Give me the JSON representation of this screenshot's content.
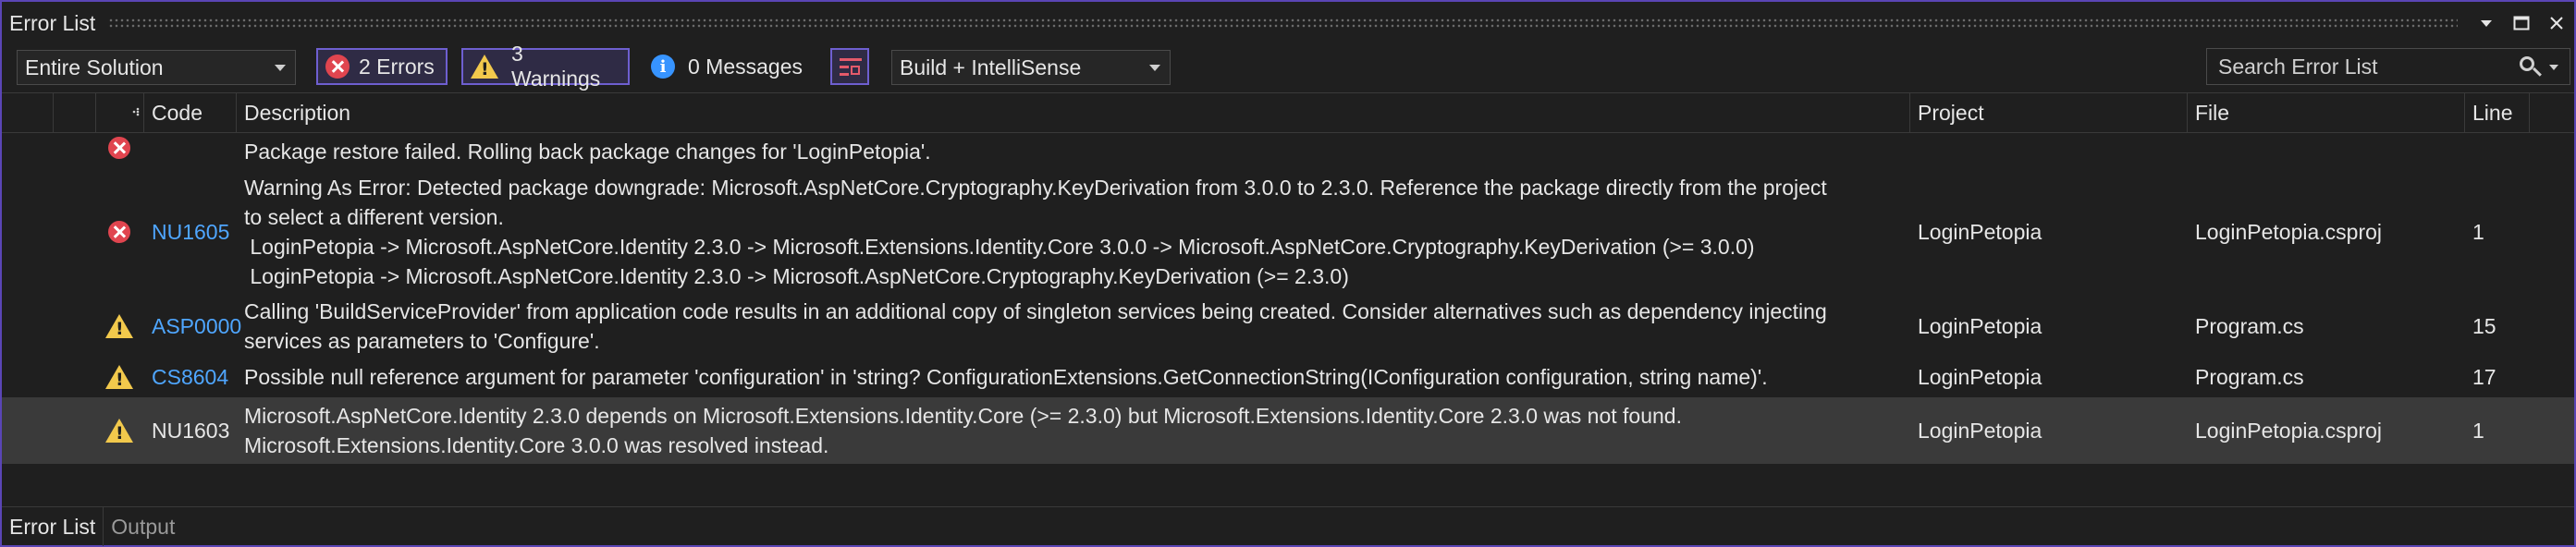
{
  "window": {
    "title": "Error List",
    "buttons": [
      "dropdown-icon",
      "maximize-icon",
      "close-icon"
    ]
  },
  "toolbar": {
    "scope_value": "Entire Solution",
    "errors_label": "2 Errors",
    "warnings_label": "3 Warnings",
    "messages_label": "0 Messages",
    "source_value": "Build + IntelliSense",
    "search_placeholder": "Search Error List"
  },
  "columns": {
    "code": "Code",
    "description": "Description",
    "project": "Project",
    "file": "File",
    "line": "Line"
  },
  "rows": [
    {
      "severity": "error",
      "code": "",
      "description": "Package restore failed. Rolling back package changes for 'LoginPetopia'.",
      "project": "",
      "file": "",
      "line": ""
    },
    {
      "severity": "error",
      "code": "NU1605",
      "description": "Warning As Error: Detected package downgrade: Microsoft.AspNetCore.Cryptography.KeyDerivation from 3.0.0 to 2.3.0. Reference the package directly from the project\nto select a different version.\n LoginPetopia -> Microsoft.AspNetCore.Identity 2.3.0 -> Microsoft.Extensions.Identity.Core 3.0.0 -> Microsoft.AspNetCore.Cryptography.KeyDerivation (>= 3.0.0)\n LoginPetopia -> Microsoft.AspNetCore.Identity 2.3.0 -> Microsoft.AspNetCore.Cryptography.KeyDerivation (>= 2.3.0)",
      "project": "LoginPetopia",
      "file": "LoginPetopia.csproj",
      "line": "1"
    },
    {
      "severity": "warning",
      "code": "ASP0000",
      "description": "Calling 'BuildServiceProvider' from application code results in an additional copy of singleton services being created. Consider alternatives such as dependency injecting\nservices as parameters to 'Configure'.",
      "project": "LoginPetopia",
      "file": "Program.cs",
      "line": "15"
    },
    {
      "severity": "warning",
      "code": "CS8604",
      "description": "Possible null reference argument for parameter 'configuration' in 'string? ConfigurationExtensions.GetConnectionString(IConfiguration configuration, string name)'.",
      "project": "LoginPetopia",
      "file": "Program.cs",
      "line": "17"
    },
    {
      "severity": "warning",
      "code": "NU1603",
      "description": "Microsoft.AspNetCore.Identity 2.3.0 depends on Microsoft.Extensions.Identity.Core (>= 2.3.0) but Microsoft.Extensions.Identity.Core 2.3.0 was not found.\nMicrosoft.Extensions.Identity.Core 3.0.0 was resolved instead.",
      "project": "LoginPetopia",
      "file": "LoginPetopia.csproj",
      "line": "1"
    }
  ],
  "tabs": [
    "Error List",
    "Output"
  ],
  "colors": {
    "accent": "#6e5fd0",
    "error": "#e0454f",
    "warning": "#f2c94c",
    "info": "#3794ff",
    "link": "#4fa6ff"
  }
}
